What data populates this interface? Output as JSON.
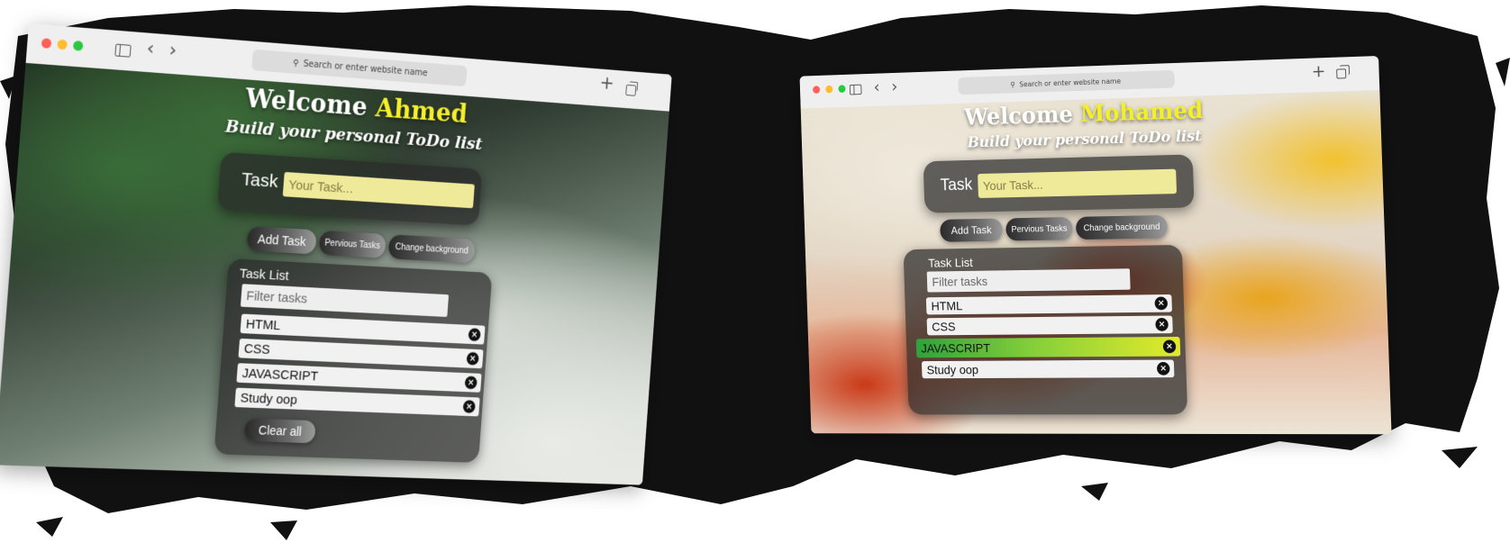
{
  "browser": {
    "address_placeholder": "Search or enter website name",
    "back_glyph": "‹",
    "forward_glyph": "›",
    "new_tab_glyph": "+",
    "search_glyph": "⚲"
  },
  "windows": [
    {
      "welcome_prefix": "Welcome",
      "user_name": "Ahmed",
      "subtitle": "Build your personal ToDo list",
      "task_label": "Task",
      "task_placeholder": "Your Task...",
      "add_button": "Add Task",
      "previous_button": "Pervious Tasks",
      "background_button": "Change background",
      "list_title": "Task List",
      "filter_placeholder": "Filter tasks",
      "tasks": [
        "HTML",
        "CSS",
        "JAVASCRIPT",
        "Study oop"
      ],
      "clear_button": "Clear all"
    },
    {
      "welcome_prefix": "Welcome",
      "user_name": "Mohamed",
      "subtitle": "Build your personal ToDo list",
      "task_label": "Task",
      "task_placeholder": "Your Task...",
      "add_button": "Add Task",
      "previous_button": "Pervious Tasks",
      "background_button": "Change background",
      "list_title": "Task List",
      "filter_placeholder": "Filter tasks",
      "tasks": [
        "HTML",
        "CSS",
        "JAVASCRIPT",
        "Study oop"
      ],
      "highlighted_task": "JAVASCRIPT"
    }
  ],
  "colors": {
    "name_accent": "#f3ef2b",
    "task_input_bg": "#efe99a",
    "highlight_gradient_start": "#2ea23a",
    "highlight_gradient_end": "#e3ea2a"
  },
  "icons": {
    "delete": "×"
  }
}
